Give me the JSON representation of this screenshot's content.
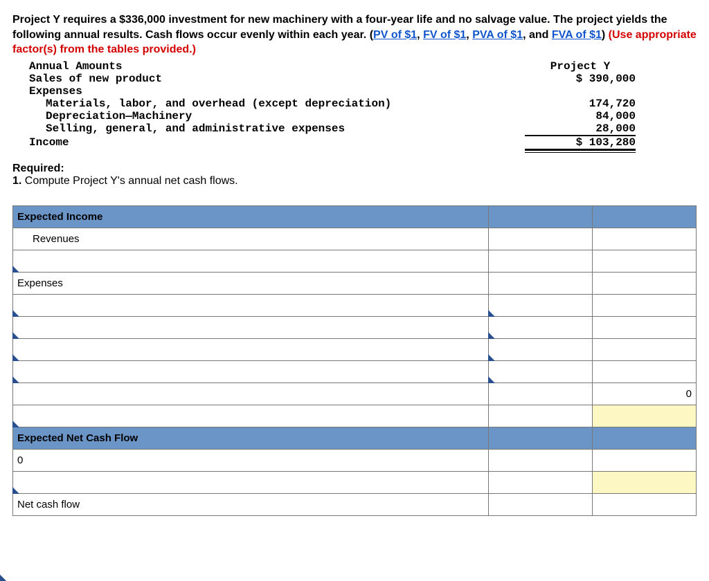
{
  "problem": {
    "line1a": "Project Y requires a $336,000 investment for new machinery with a four-year life and no salvage value. The project yields the following annual results. Cash flows occur evenly within each year. (",
    "pv": "PV of $1",
    "sep1": ", ",
    "fv": "FV of $1",
    "sep2": ", ",
    "pva": "PVA of $1",
    "sep3": ", and ",
    "fva": "FVA of $1",
    "line1b": ") ",
    "red": "(Use appropriate factor(s) from the tables provided.)"
  },
  "mono": {
    "annual_amounts": "Annual Amounts",
    "project_y": "Project Y",
    "sales_label": "Sales of new product",
    "sales_val": "$ 390,000",
    "expenses_header": "Expenses",
    "materials_label": "Materials, labor, and overhead (except depreciation)",
    "materials_val": "174,720",
    "dep_label": "Depreciation—Machinery",
    "dep_val": "84,000",
    "sga_label": "Selling, general, and administrative expenses",
    "sga_val": "28,000",
    "income_label": "Income",
    "income_val": "$ 103,280"
  },
  "required": {
    "title": "Required:",
    "item1_num": "1.",
    "item1_text": " Compute Project Y's annual net cash flows."
  },
  "grid": {
    "header1": "Expected Income",
    "revenues": "Revenues",
    "expenses": "Expenses",
    "zero": "0",
    "header2": "Expected Net Cash Flow",
    "zero2": "0",
    "net_cash_flow": "Net cash flow"
  }
}
